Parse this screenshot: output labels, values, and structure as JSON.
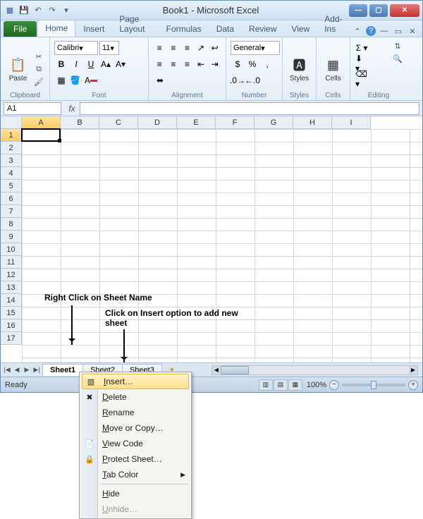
{
  "window": {
    "title": "Book1 - Microsoft Excel"
  },
  "qat": {
    "save": "💾",
    "undo": "↶",
    "redo": "↷"
  },
  "tabs": {
    "file": "File",
    "items": [
      "Home",
      "Insert",
      "Page Layout",
      "Formulas",
      "Data",
      "Review",
      "View",
      "Add-Ins"
    ],
    "active": "Home"
  },
  "ribbon": {
    "clipboard": {
      "label": "Clipboard",
      "paste": "Paste"
    },
    "font": {
      "label": "Font",
      "name": "Calibri",
      "size": "11",
      "buttons": {
        "bold": "B",
        "italic": "I",
        "underline": "U"
      }
    },
    "alignment": {
      "label": "Alignment"
    },
    "number": {
      "label": "Number",
      "format": "General"
    },
    "styles": {
      "label": "Styles",
      "btn": "Styles"
    },
    "cells": {
      "label": "Cells",
      "btn": "Cells"
    },
    "editing": {
      "label": "Editing"
    }
  },
  "namebox": "A1",
  "fx": "fx",
  "columns": [
    "A",
    "B",
    "C",
    "D",
    "E",
    "F",
    "G",
    "H",
    "I"
  ],
  "rows": [
    "1",
    "2",
    "3",
    "4",
    "5",
    "6",
    "7",
    "8",
    "9",
    "10",
    "11",
    "12",
    "13",
    "14",
    "15",
    "16",
    "17"
  ],
  "selected": {
    "col": "A",
    "row": "1"
  },
  "annotations": {
    "a1": "Right Click on Sheet Name",
    "a2": "Click on Insert option to add new sheet"
  },
  "sheetTabs": [
    "Sheet1",
    "Sheet2",
    "Sheet3"
  ],
  "status": {
    "ready": "Ready",
    "zoom": "100%"
  },
  "contextMenu": {
    "insert": "Insert…",
    "delete": "Delete",
    "rename": "Rename",
    "move": "Move or Copy…",
    "viewcode": "View Code",
    "protect": "Protect Sheet…",
    "tabcolor": "Tab Color",
    "hide": "Hide",
    "unhide": "Unhide…"
  }
}
